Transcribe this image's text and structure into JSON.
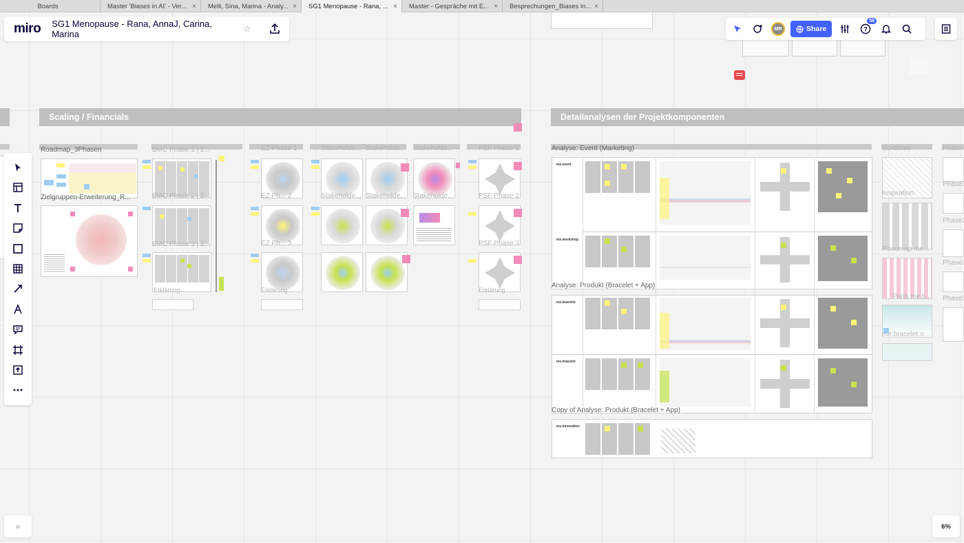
{
  "browser_tabs": [
    {
      "label": "Boards",
      "close": ""
    },
    {
      "label": "Master 'Biases in AI' - Ver...",
      "close": "×"
    },
    {
      "label": "Melli, Sina, Marina - Analy...",
      "close": "×"
    },
    {
      "label": "SG1 Menopause - Rana, ...",
      "close": "×"
    },
    {
      "label": "Master - Gespräche mit E...",
      "close": "×"
    },
    {
      "label": "Besprechungen_Biases in...",
      "close": "×"
    }
  ],
  "header": {
    "logo": "miro",
    "board_title": "SG1 Menopause - Rana, AnnaJ, Carina, Marina"
  },
  "toolbar_right": {
    "avatar_initials": "MR",
    "share_label": "Share",
    "notification_count": "56"
  },
  "zoom": "6%",
  "expand_label": "»",
  "sections": {
    "scaling": "Scaling / Financials",
    "detail": "Detailanalysen der Projektkomponenten"
  },
  "frame_labels": {
    "roadmap": "Roadmap_3Phasen",
    "zielgruppen": "Zielgruppen-Erweiterung_R...",
    "bmc1": "BMC Phase 1 | 2...",
    "bmc2": "BMC Phase 2 | 2...",
    "bmc3": "BMC Phase 3 | 2...",
    "ez1": "EZ Phase 1",
    "ez2": "EZ Ph... 2",
    "ez3": "EZ Ph... 3",
    "stake1": "Stakeholde...",
    "stake2": "Stakeholde...",
    "stake3": "Stakeholde...",
    "psf1": "PSF Phase 1",
    "psf2": "PSF Phase 2",
    "psf3": "PSF Phase 3",
    "erklarung1": "Erklärung...",
    "erklarung2": "Erklärung...",
    "analyse_event": "Analyse: Event (Marketing)",
    "analyse_produkt": "Analyse: Produkt (Bracelet + App)",
    "copy_analyse": "Copy of Analyse: Produkt (Bracelet + App)",
    "scribbles": "Scribbles",
    "inspiration": "Inspiration",
    "roadmap_me": "Roadmap me...",
    "parts_me": "Parts me.b...",
    "me_bracelet": "me.bracelet.o...",
    "phase_e": "Phase E",
    "phase3a": "Phase3",
    "phase2": "Phase2",
    "phase3b": "Phase3",
    "phase3c": "Phase3"
  },
  "row_titles": {
    "event": "me.event",
    "workshop": "me.workshop",
    "bracelet1": "me.bracelet",
    "bracelet2": "me.bracelet",
    "innovation": "me.innovation"
  },
  "icons": {
    "select": "cursor-icon",
    "templates": "template-icon",
    "text": "text-icon",
    "sticky": "sticky-note-icon",
    "shape": "shape-icon",
    "table": "table-icon",
    "connector": "arrow-icon",
    "pen": "pen-icon",
    "comment": "comment-icon",
    "frame": "frame-icon",
    "upload": "upload-icon",
    "more": "more-icon"
  },
  "colors": {
    "accent": "#4262ff",
    "sticky_yellow": "#fff47a",
    "sticky_green": "#c6e24f",
    "sticky_pink": "#f28bb8",
    "comment_red": "#e5484d"
  }
}
